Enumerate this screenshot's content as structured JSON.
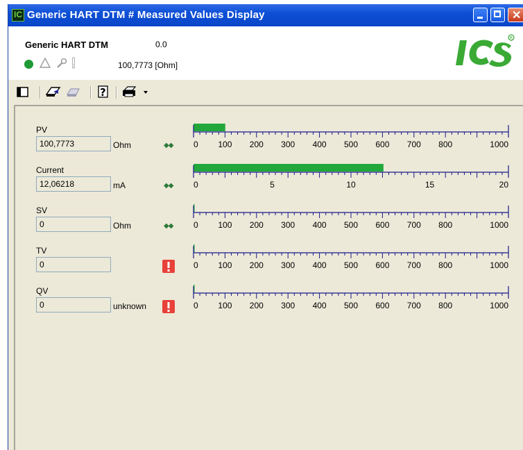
{
  "window": {
    "title": "Generic HART DTM # Measured Values Display"
  },
  "header": {
    "device_name": "Generic HART DTM",
    "device_value": "0.0",
    "status_value": "100,7773 [Ohm]"
  },
  "toolbar": {
    "icons": [
      "panel-icon",
      "upload-icon",
      "download-icon",
      "help-icon",
      "print-icon",
      "dropdown-arrow-icon"
    ]
  },
  "colors": {
    "bar": "#22a83a",
    "scale": "#1a1a8a",
    "title": "#0a46c8"
  },
  "rows": [
    {
      "label": "PV",
      "value": "100,7773",
      "unit": "Ohm",
      "status": "ok",
      "range": [
        0,
        1000
      ],
      "fill": 100.7773,
      "ticks": [
        "0",
        "100",
        "200",
        "300",
        "400",
        "500",
        "600",
        "700",
        "800",
        "1000"
      ]
    },
    {
      "label": "Current",
      "value": "12,06218",
      "unit": "mA",
      "status": "ok",
      "range": [
        0,
        20
      ],
      "fill": 12.06218,
      "ticks": [
        "0",
        "5",
        "10",
        "15",
        "20"
      ]
    },
    {
      "label": "SV",
      "value": "0",
      "unit": "Ohm",
      "status": "ok",
      "range": [
        0,
        1000
      ],
      "fill": 0,
      "ticks": [
        "0",
        "100",
        "200",
        "300",
        "400",
        "500",
        "600",
        "700",
        "800",
        "1000"
      ]
    },
    {
      "label": "TV",
      "value": "0",
      "unit": "",
      "status": "error",
      "range": [
        0,
        1000
      ],
      "fill": 0,
      "ticks": [
        "0",
        "100",
        "200",
        "300",
        "400",
        "500",
        "600",
        "700",
        "800",
        "1000"
      ]
    },
    {
      "label": "QV",
      "value": "0",
      "unit": "unknown",
      "status": "error",
      "range": [
        0,
        1000
      ],
      "fill": 0,
      "ticks": [
        "0",
        "100",
        "200",
        "300",
        "400",
        "500",
        "600",
        "700",
        "800",
        "1000"
      ]
    }
  ]
}
